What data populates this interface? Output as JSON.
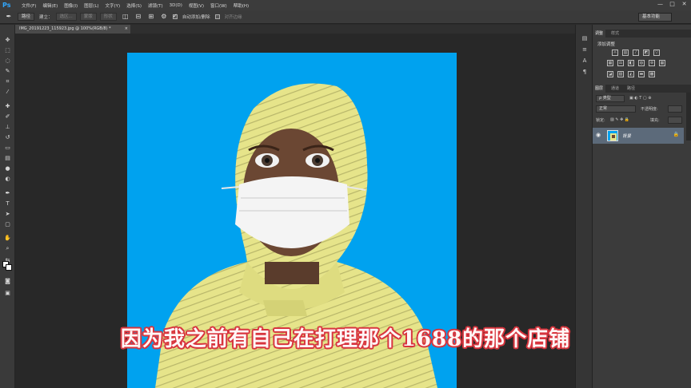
{
  "app": {
    "logo": "Ps"
  },
  "menu": [
    "文件(F)",
    "编辑(E)",
    "图像(I)",
    "图层(L)",
    "文字(Y)",
    "选择(S)",
    "滤镜(T)",
    "3D(D)",
    "视图(V)",
    "窗口(W)",
    "帮助(H)"
  ],
  "window_controls": [
    "—",
    "□",
    "✕"
  ],
  "options": {
    "tool_mode": "路径",
    "make_label": "建立：",
    "selection_btn": "选区...",
    "mask_btn": "蒙版",
    "shape_btn": "形状",
    "auto_add_label": "自动添加/删除",
    "align_edges_label": "对齐边缘",
    "workspace": "基本功能"
  },
  "document": {
    "tab_title": "IMG_20191223_115923.jpg @ 100%(RGB/8) *",
    "close": "×"
  },
  "panels": {
    "top_tabs": [
      "调整",
      "样式"
    ],
    "adjust_title": "添加调整",
    "layer_tabs": [
      "图层",
      "通道",
      "路径"
    ],
    "kind_filter": "ρ 类型",
    "blend_mode": "正常",
    "opacity_label": "不透明度:",
    "lock_label": "锁定:",
    "fill_label": "填充:",
    "layer_name": "背景"
  },
  "colors": {
    "canvas_bg": "#00a2ef",
    "suit": "#e6e48a",
    "subtitle_stroke": "#d8353e"
  },
  "subtitle": "因为我之前有自己在打理那个1688的那个店铺"
}
